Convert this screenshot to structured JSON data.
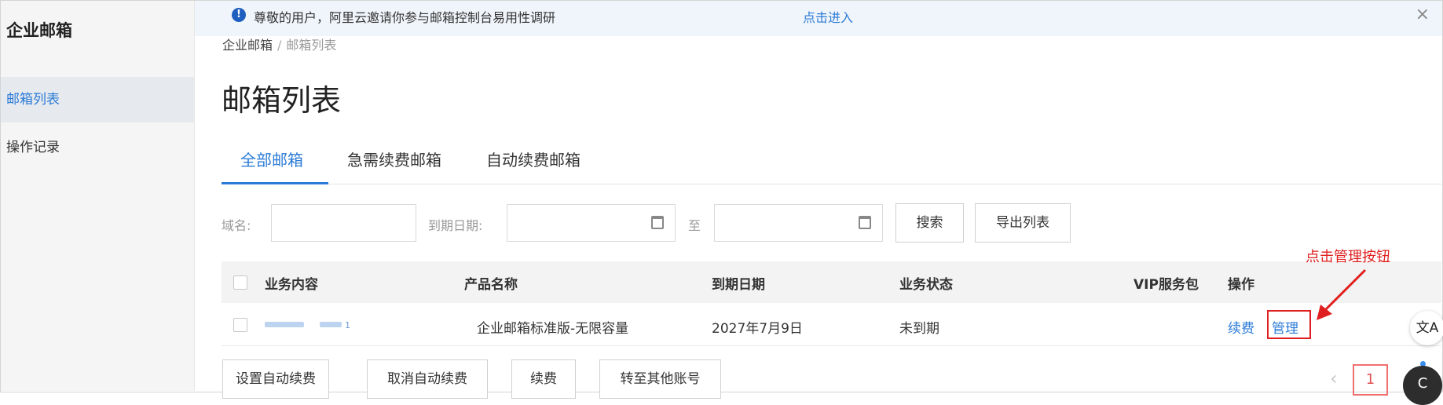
{
  "sidebar": {
    "title": "企业邮箱",
    "items": [
      {
        "label": "邮箱列表",
        "active": true
      },
      {
        "label": "操作记录",
        "active": false
      }
    ]
  },
  "notice": {
    "icon": "exclamation-icon",
    "text": "尊敬的用户，阿里云邀请你参与邮箱控制台易用性调研",
    "link": "点击进入",
    "close": "×"
  },
  "breadcrumb": {
    "root": "企业邮箱",
    "separator": "/",
    "current": "邮箱列表"
  },
  "page_title": "邮箱列表",
  "tabs": [
    "全部邮箱",
    "急需续费邮箱",
    "自动续费邮箱"
  ],
  "filters": {
    "domain_label": "域名:",
    "date_label": "到期日期:",
    "to_label": "至",
    "search_button": "搜索",
    "export_button": "导出列表"
  },
  "table": {
    "headers": [
      "业务内容",
      "产品名称",
      "到期日期",
      "业务状态",
      "VIP服务包",
      "操作"
    ],
    "rows": [
      {
        "content_tail": "1",
        "product": "企业邮箱标准版-无限容量",
        "expiry": "2027年7月9日",
        "status": "未到期",
        "vip": "",
        "renew": "续费",
        "manage": "管理"
      }
    ]
  },
  "annotation": "点击管理按钮",
  "bottom_buttons": [
    "设置自动续费",
    "取消自动续费",
    "续费",
    "转至其他账号"
  ],
  "pagination": {
    "prev": "‹",
    "current": "1"
  },
  "floating": {
    "translate": "文A",
    "assistant": "C"
  },
  "colors": {
    "accent": "#2b7bd6",
    "annotation": "#e02020",
    "sidebar_bg": "#f5f5f5",
    "header_bg": "#f3f3f3"
  }
}
